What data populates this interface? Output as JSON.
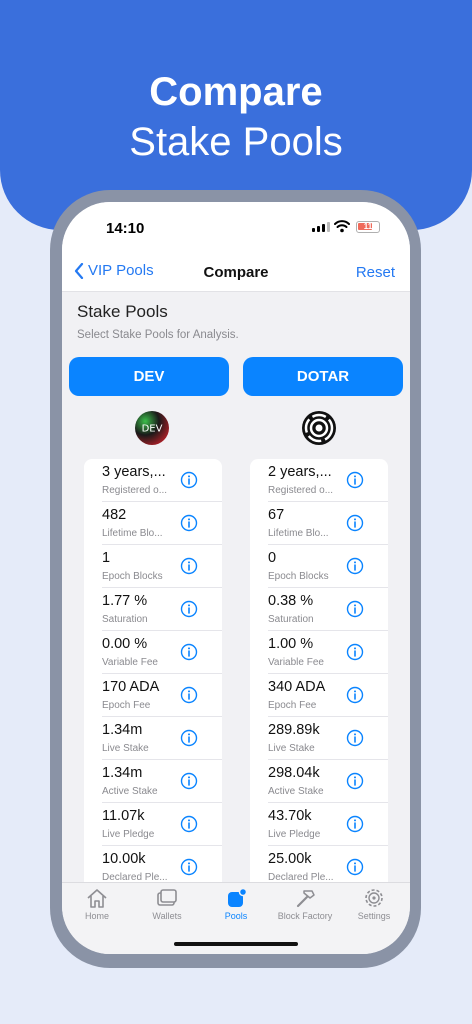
{
  "hero": {
    "line1": "Compare",
    "line2": "Stake Pools"
  },
  "status": {
    "time": "14:10",
    "battery": "11"
  },
  "nav": {
    "back_label": "VIP Pools",
    "title": "Compare",
    "reset_label": "Reset"
  },
  "section": {
    "title": "Stake Pools",
    "subtitle": "Select Stake Pools for Analysis."
  },
  "pools": {
    "left": {
      "name": "DEV",
      "rows": [
        {
          "value": "3 years,...",
          "label": "Registered o..."
        },
        {
          "value": "482",
          "label": "Lifetime Blo..."
        },
        {
          "value": "1",
          "label": "Epoch Blocks"
        },
        {
          "value": "1.77 %",
          "label": "Saturation"
        },
        {
          "value": "0.00 %",
          "label": "Variable Fee"
        },
        {
          "value": "170 ADA",
          "label": "Epoch Fee"
        },
        {
          "value": "1.34m",
          "label": "Live Stake"
        },
        {
          "value": "1.34m",
          "label": "Active Stake"
        },
        {
          "value": "11.07k",
          "label": "Live Pledge"
        },
        {
          "value": "10.00k",
          "label": "Declared Ple..."
        }
      ]
    },
    "right": {
      "name": "DOTAR",
      "rows": [
        {
          "value": "2 years,...",
          "label": "Registered o..."
        },
        {
          "value": "67",
          "label": "Lifetime Blo..."
        },
        {
          "value": "0",
          "label": "Epoch Blocks"
        },
        {
          "value": "0.38 %",
          "label": "Saturation"
        },
        {
          "value": "1.00 %",
          "label": "Variable Fee"
        },
        {
          "value": "340 ADA",
          "label": "Epoch Fee"
        },
        {
          "value": "289.89k",
          "label": "Live Stake"
        },
        {
          "value": "298.04k",
          "label": "Active Stake"
        },
        {
          "value": "43.70k",
          "label": "Live Pledge"
        },
        {
          "value": "25.00k",
          "label": "Declared Ple..."
        }
      ]
    }
  },
  "tabs": [
    {
      "label": "Home",
      "icon": "house-icon"
    },
    {
      "label": "Wallets",
      "icon": "wallet-icon"
    },
    {
      "label": "Pools",
      "icon": "pools-icon",
      "active": true
    },
    {
      "label": "Block Factory",
      "icon": "hammer-icon"
    },
    {
      "label": "Settings",
      "icon": "gear-icon"
    }
  ],
  "colors": {
    "accent": "#0a84ff",
    "hero": "#3a6fdc",
    "background": "#e5ebf9"
  }
}
